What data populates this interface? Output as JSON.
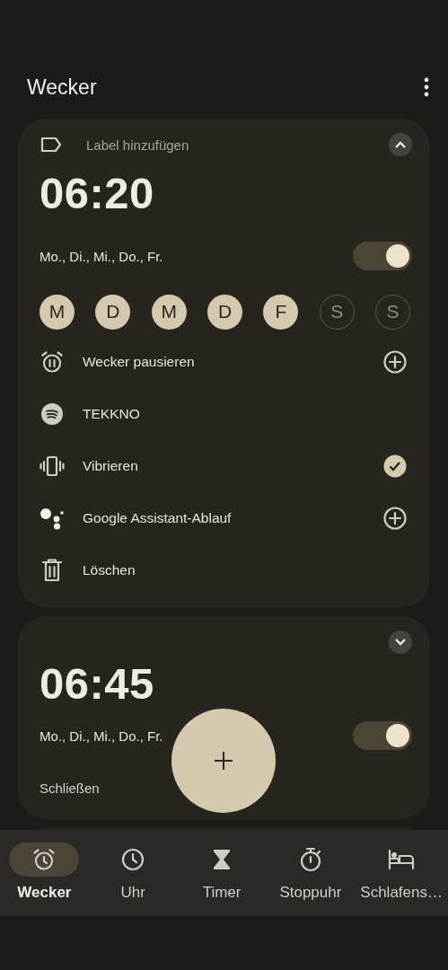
{
  "app_bar": {
    "title": "Wecker"
  },
  "alarms": [
    {
      "add_label": "Label hinzufügen",
      "expanded": true,
      "time": "06:20",
      "days_summary": "Mo., Di., Mi., Do., Fr.",
      "on": true,
      "days": [
        {
          "letter": "M",
          "selected": true
        },
        {
          "letter": "D",
          "selected": true
        },
        {
          "letter": "M",
          "selected": true
        },
        {
          "letter": "D",
          "selected": true
        },
        {
          "letter": "F",
          "selected": true
        },
        {
          "letter": "S",
          "selected": false
        },
        {
          "letter": "S",
          "selected": false
        }
      ],
      "options": [
        {
          "kind": "pause",
          "label": "Wecker pausieren",
          "addable": true
        },
        {
          "kind": "music",
          "label": "TEKKNO",
          "addable": false
        },
        {
          "kind": "vibrate",
          "label": "Vibrieren",
          "checked": true,
          "addable": false
        },
        {
          "kind": "assistant",
          "label": "Google Assistant-Ablauf",
          "addable": true
        },
        {
          "kind": "delete",
          "label": "Löschen",
          "addable": false
        }
      ]
    },
    {
      "expanded": false,
      "time": "06:45",
      "days_summary": "Mo., Di., Mi., Do., Fr.",
      "on": true,
      "dismiss": "Schließen"
    }
  ],
  "tabs": [
    {
      "kind": "alarm",
      "label": "Wecker",
      "selected": true
    },
    {
      "kind": "clock",
      "label": "Uhr",
      "selected": false
    },
    {
      "kind": "timer",
      "label": "Timer",
      "selected": false
    },
    {
      "kind": "stopwatch",
      "label": "Stoppuhr",
      "selected": false
    },
    {
      "kind": "bedtime",
      "label": "Schlafens…",
      "selected": false
    }
  ]
}
